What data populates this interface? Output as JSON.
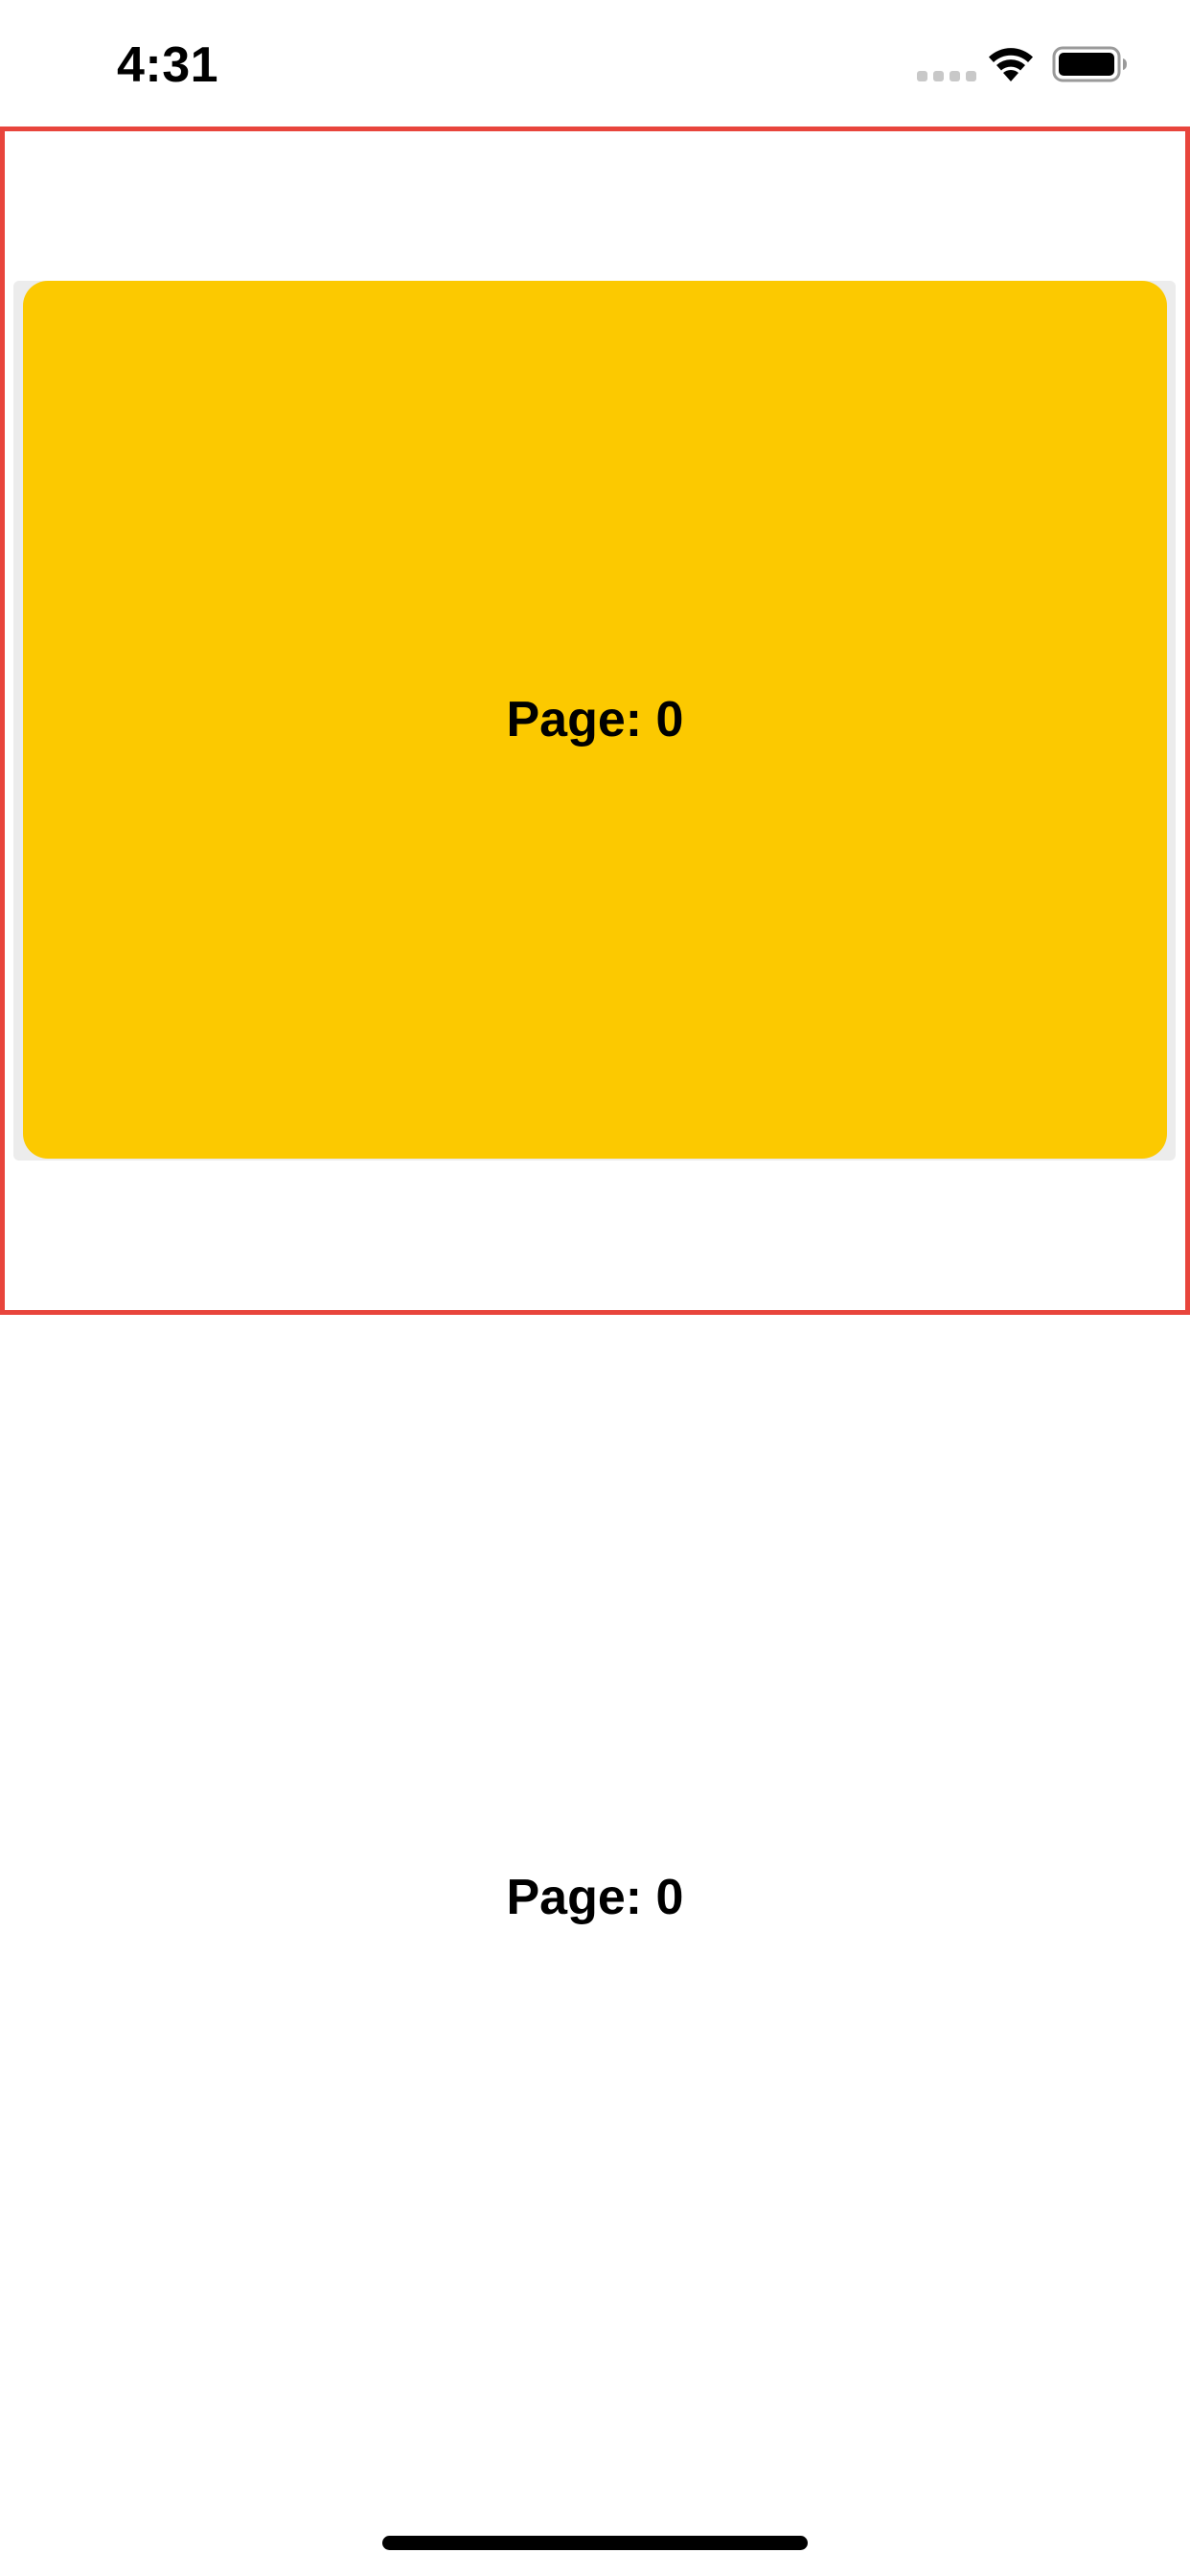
{
  "status_bar": {
    "time": "4:31",
    "icons": [
      "cellular-signal-icon",
      "wifi-icon",
      "battery-icon"
    ]
  },
  "pager": {
    "card_label": "Page: 0",
    "card_color": "#FCC900",
    "frame_border_color": "#E8453C"
  },
  "current_page_label": "Page: 0"
}
